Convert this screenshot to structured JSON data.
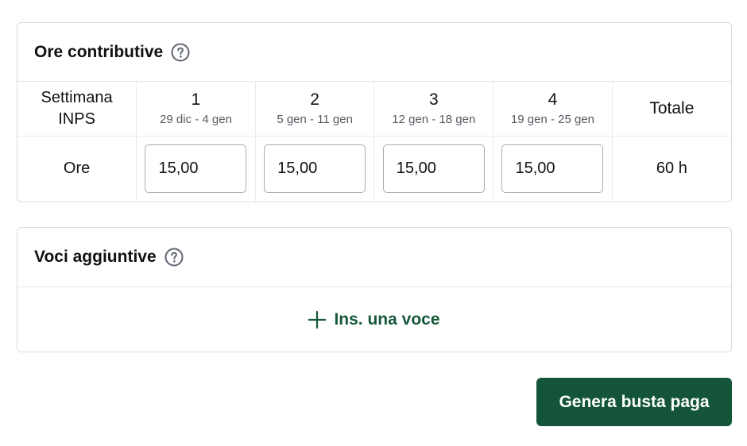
{
  "ore_contributive": {
    "title": "Ore contributive",
    "help_icon": "question-circle-icon",
    "header_label": "Settimana INPS",
    "weeks": [
      {
        "number": "1",
        "range": "29 dic - 4 gen",
        "hours": "15,00"
      },
      {
        "number": "2",
        "range": "5 gen - 11 gen",
        "hours": "15,00"
      },
      {
        "number": "3",
        "range": "12 gen - 18 gen",
        "hours": "15,00"
      },
      {
        "number": "4",
        "range": "19 gen - 25 gen",
        "hours": "15,00"
      }
    ],
    "totale_label": "Totale",
    "row_label": "Ore",
    "totale_value": "60 h"
  },
  "voci_aggiuntive": {
    "title": "Voci aggiuntive",
    "help_icon": "question-circle-icon",
    "add_label": "Ins. una voce",
    "add_icon": "plus-icon"
  },
  "actions": {
    "generate_label": "Genera busta paga"
  },
  "colors": {
    "accent": "#17593a",
    "primary_button": "#14553a",
    "border": "#d9dce0",
    "icon_gray": "#5f6570"
  }
}
